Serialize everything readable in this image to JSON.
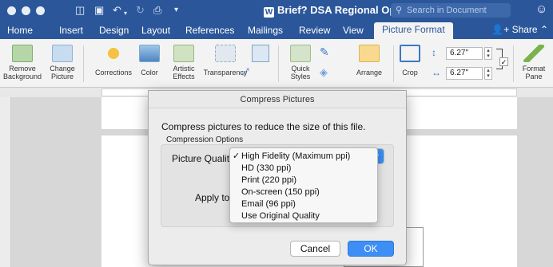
{
  "window": {
    "title": "Brief? DSA Regional Open Call"
  },
  "search": {
    "placeholder": "Search in Document"
  },
  "tabs": [
    {
      "label": "Home"
    },
    {
      "label": "Insert"
    },
    {
      "label": "Design"
    },
    {
      "label": "Layout"
    },
    {
      "label": "References"
    },
    {
      "label": "Mailings"
    },
    {
      "label": "Review"
    },
    {
      "label": "View"
    },
    {
      "label": "Picture Format"
    }
  ],
  "share_label": "Share",
  "ribbon": {
    "remove_background": [
      "Remove",
      "Background"
    ],
    "change_picture": [
      "Change",
      "Picture"
    ],
    "corrections": "Corrections",
    "color": "Color",
    "artistic_effects": [
      "Artistic",
      "Effects"
    ],
    "transparency": "Transparency",
    "quick_styles": [
      "Quick",
      "Styles"
    ],
    "arrange": "Arrange",
    "crop": "Crop",
    "height_value": "6.27\"",
    "width_value": "6.27\"",
    "format_pane": [
      "Format",
      "Pane"
    ]
  },
  "dialog": {
    "title": "Compress Pictures",
    "description": "Compress pictures to reduce the size of this file.",
    "section_label": "Compression Options",
    "picture_quality_label": "Picture Quality",
    "apply_to_label": "Apply to",
    "quality_options": [
      {
        "label": "High Fidelity (Maximum ppi)",
        "checked": true
      },
      {
        "label": "HD (330 ppi)",
        "checked": false
      },
      {
        "label": "Print (220 ppi)",
        "checked": false
      },
      {
        "label": "On-screen (150 ppi)",
        "checked": false
      },
      {
        "label": "Email (96 ppi)",
        "checked": false
      },
      {
        "label": "Use Original Quality",
        "checked": false
      }
    ],
    "cancel_label": "Cancel",
    "ok_label": "OK"
  },
  "colors": {
    "accent": "#2b579a",
    "ok_button": "#3d8ef5"
  }
}
